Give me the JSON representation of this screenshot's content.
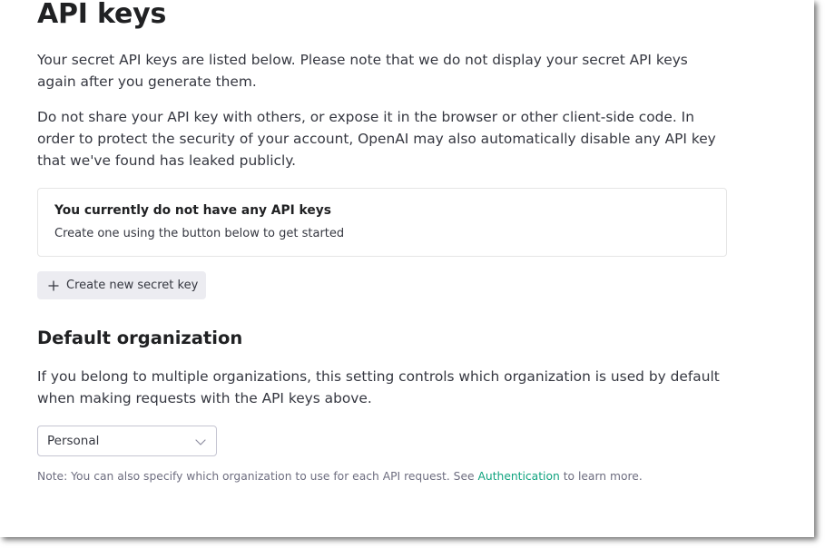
{
  "page": {
    "title": "API keys",
    "intro_1": "Your secret API keys are listed below. Please note that we do not display your secret API keys again after you generate them.",
    "intro_2": "Do not share your API key with others, or expose it in the browser or other client-side code. In order to protect the security of your account, OpenAI may also automatically disable any API key that we've found has leaked publicly."
  },
  "empty_state": {
    "title": "You currently do not have any API keys",
    "subtitle": "Create one using the button below to get started"
  },
  "create_button": {
    "icon": "plus-icon",
    "label": "Create new secret key"
  },
  "default_org": {
    "heading": "Default organization",
    "description": "If you belong to multiple organizations, this setting controls which organization is used by default when making requests with the API keys above.",
    "selected": "Personal",
    "note_prefix": "Note: You can also specify which organization to use for each API request. See ",
    "note_link": "Authentication",
    "note_suffix": " to learn more."
  },
  "colors": {
    "link": "#10a37f",
    "button_bg": "#ececf1",
    "text": "#353740"
  }
}
